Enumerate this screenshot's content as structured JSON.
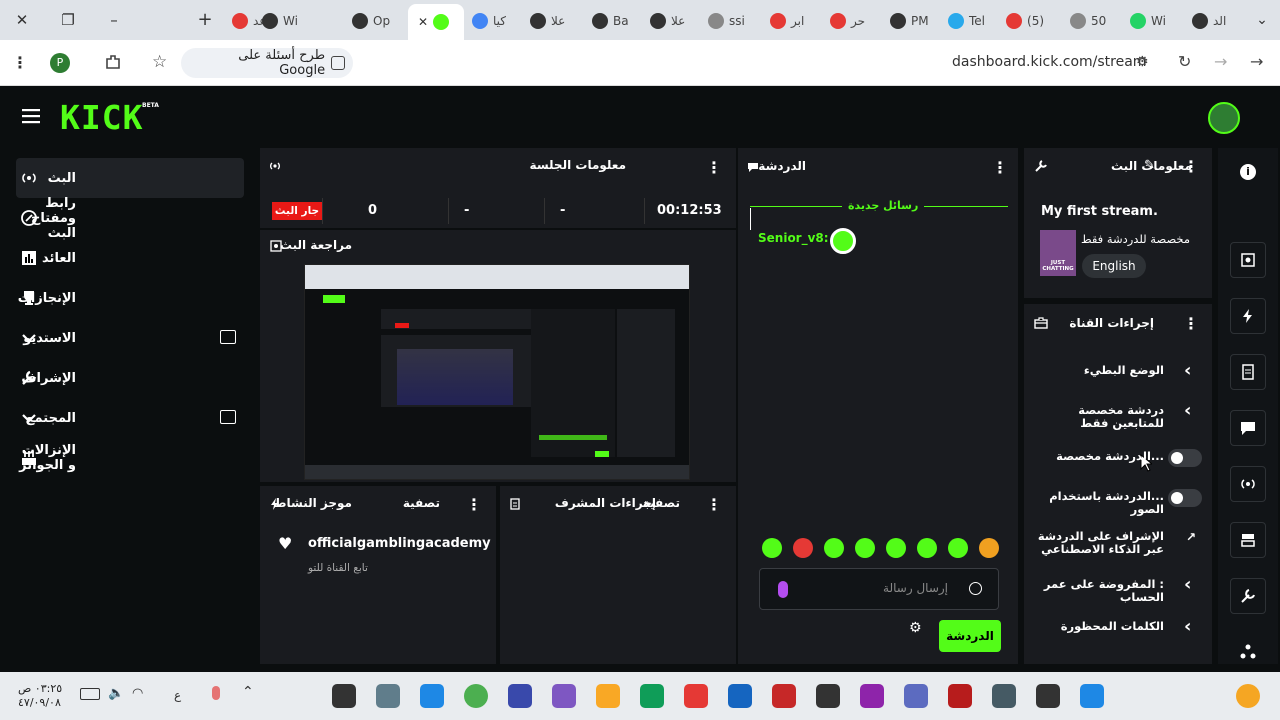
{
  "browser": {
    "tabs": [
      {
        "label": "عد",
        "color": "#e53935"
      },
      {
        "label": "Wi",
        "color": "#333"
      },
      {
        "label": "Op",
        "color": "#333"
      },
      {
        "label": "",
        "color": "#53fc18",
        "active": true
      },
      {
        "label": "كيا",
        "color": "#4285f4"
      },
      {
        "label": "علا",
        "color": "#333"
      },
      {
        "label": "Ba",
        "color": "#333"
      },
      {
        "label": "علا",
        "color": "#333"
      },
      {
        "label": "ssi",
        "color": "#888"
      },
      {
        "label": "ابر",
        "color": "#e53935"
      },
      {
        "label": "حر",
        "color": "#e53935"
      },
      {
        "label": "PM",
        "color": "#333"
      },
      {
        "label": "Tel",
        "color": "#29a9eb"
      },
      {
        "label": "(5)",
        "color": "#e53935"
      },
      {
        "label": "50",
        "color": "#888"
      },
      {
        "label": "Wi",
        "color": "#25d366"
      },
      {
        "label": "الد",
        "color": "#333"
      }
    ],
    "url": "dashboard.kick.com/stream",
    "google_ask": "طرح أسئلة على Google",
    "profile_initial": "P"
  },
  "kick": {
    "logo": "KICK",
    "beta": "BETA"
  },
  "sidebar": {
    "items": [
      {
        "label": "البث",
        "icon": "broadcast-icon",
        "active": true
      },
      {
        "label": "رابط ومفتاح البث",
        "icon": "link-icon"
      },
      {
        "label": "العائد",
        "icon": "chart-icon"
      },
      {
        "label": "الإنجازات",
        "icon": "trophy-icon"
      },
      {
        "label": "الاستديو",
        "icon": "studio-icon",
        "expand": true
      },
      {
        "label": "الإشراف",
        "icon": "wrench-icon"
      },
      {
        "label": "المجتمع",
        "icon": "community-icon",
        "expand": true
      },
      {
        "label": "الإنزالات و الجوائز",
        "icon": "drops-icon"
      }
    ]
  },
  "session": {
    "title": "معلومات الجلسة",
    "live_badge": "جار البث",
    "viewers": "0",
    "dash1": "-",
    "dash2": "-",
    "duration": "00:12:53"
  },
  "preview": {
    "title": "مراجعة البث"
  },
  "activity": {
    "title": "موجز النشاط",
    "filter": "تصفية",
    "follower_name": "officialgamblingacademy",
    "follower_action": "تابع القناة للتو"
  },
  "mod_actions": {
    "title": "إجراءات المشرف",
    "filter": "تصفية"
  },
  "chat": {
    "title": "الدردشة",
    "new_messages": "رسائل جديدة",
    "message_user": "Senior_v8:",
    "input_placeholder": "إرسال رسالة",
    "send_label": "الدردشة",
    "emotes": [
      "#53fc18",
      "#e53935",
      "#53fc18",
      "#53fc18",
      "#53fc18",
      "#53fc18",
      "#53fc18",
      "#f0a020"
    ]
  },
  "stream_info": {
    "title": "معلومات البث",
    "stream_title": "My first stream.",
    "category_label": "مخصصة للدردشة فقط",
    "language": "English",
    "thumb_text": "JUST CHATTING"
  },
  "channel_actions": {
    "title": "إجراءات القناة",
    "rows": [
      {
        "label": "الوضع البطيء",
        "control": "chevron"
      },
      {
        "label": "دردشة مخصصة للمتابعين فقط",
        "control": "chevron"
      },
      {
        "label": "...الدردشة مخصصة",
        "control": "toggle"
      },
      {
        "label": "...الدردشة باستخدام الصور",
        "control": "toggle"
      },
      {
        "label": "الإشراف على الدردشة عبر الذكاء الاصطناعي",
        "control": "external"
      },
      {
        "label": ": المفروضة على عمر الحساب",
        "control": "chevron"
      },
      {
        "label": "الكلمات المحظورة",
        "control": "chevron"
      }
    ]
  },
  "taskbar": {
    "time": "٠٣:٢٥ ص",
    "date": "٤٧/٠٩/٠٨",
    "lang": "ع",
    "m365_label": "M365"
  }
}
